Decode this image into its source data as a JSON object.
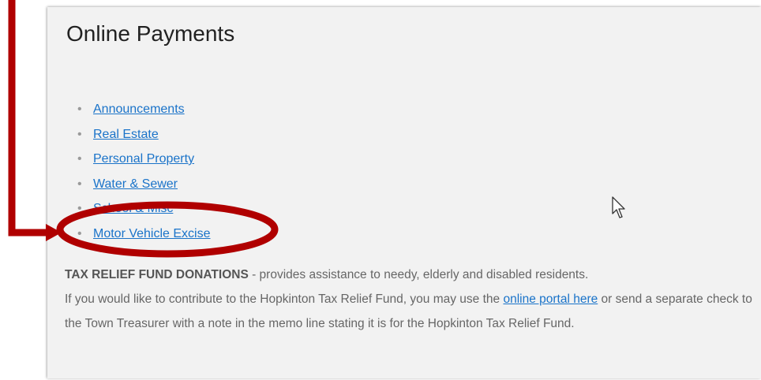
{
  "panel": {
    "title": "Online Payments",
    "links": [
      {
        "label": "Announcements"
      },
      {
        "label": "Real Estate"
      },
      {
        "label": "Personal Property"
      },
      {
        "label": "Water & Sewer"
      },
      {
        "label": "School & Misc"
      },
      {
        "label": "Motor Vehicle Excise"
      }
    ],
    "bullet_glyph": "•"
  },
  "donation": {
    "heading": "TAX RELIEF FUND DONATIONS",
    "heading_suffix": " - provides assistance to needy, elderly and disabled residents.",
    "text_before_link": "If you would like to contribute to the Hopkinton Tax Relief Fund, you may use the ",
    "link_label": "online portal here",
    "text_after_link": " or send a separate check to the Town Treasurer with a note in the memo line stating it is for the Hopkinton Tax Relief Fund."
  },
  "annotation": {
    "color": "#b00000",
    "highlighted_item": "Motor Vehicle Excise"
  },
  "colors": {
    "link": "#1a73c9",
    "panel_bg": "#f2f2f2",
    "body_text": "#666666"
  }
}
